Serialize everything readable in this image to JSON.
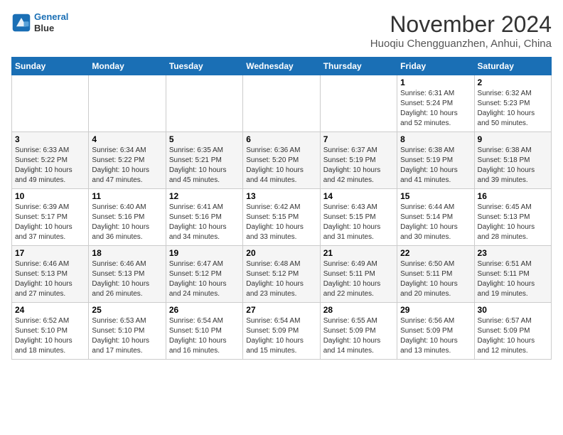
{
  "logo": {
    "line1": "General",
    "line2": "Blue"
  },
  "title": "November 2024",
  "location": "Huoqiu Chengguanzhen, Anhui, China",
  "weekdays": [
    "Sunday",
    "Monday",
    "Tuesday",
    "Wednesday",
    "Thursday",
    "Friday",
    "Saturday"
  ],
  "weeks": [
    [
      {
        "day": "",
        "info": ""
      },
      {
        "day": "",
        "info": ""
      },
      {
        "day": "",
        "info": ""
      },
      {
        "day": "",
        "info": ""
      },
      {
        "day": "",
        "info": ""
      },
      {
        "day": "1",
        "info": "Sunrise: 6:31 AM\nSunset: 5:24 PM\nDaylight: 10 hours and 52 minutes."
      },
      {
        "day": "2",
        "info": "Sunrise: 6:32 AM\nSunset: 5:23 PM\nDaylight: 10 hours and 50 minutes."
      }
    ],
    [
      {
        "day": "3",
        "info": "Sunrise: 6:33 AM\nSunset: 5:22 PM\nDaylight: 10 hours and 49 minutes."
      },
      {
        "day": "4",
        "info": "Sunrise: 6:34 AM\nSunset: 5:22 PM\nDaylight: 10 hours and 47 minutes."
      },
      {
        "day": "5",
        "info": "Sunrise: 6:35 AM\nSunset: 5:21 PM\nDaylight: 10 hours and 45 minutes."
      },
      {
        "day": "6",
        "info": "Sunrise: 6:36 AM\nSunset: 5:20 PM\nDaylight: 10 hours and 44 minutes."
      },
      {
        "day": "7",
        "info": "Sunrise: 6:37 AM\nSunset: 5:19 PM\nDaylight: 10 hours and 42 minutes."
      },
      {
        "day": "8",
        "info": "Sunrise: 6:38 AM\nSunset: 5:19 PM\nDaylight: 10 hours and 41 minutes."
      },
      {
        "day": "9",
        "info": "Sunrise: 6:38 AM\nSunset: 5:18 PM\nDaylight: 10 hours and 39 minutes."
      }
    ],
    [
      {
        "day": "10",
        "info": "Sunrise: 6:39 AM\nSunset: 5:17 PM\nDaylight: 10 hours and 37 minutes."
      },
      {
        "day": "11",
        "info": "Sunrise: 6:40 AM\nSunset: 5:16 PM\nDaylight: 10 hours and 36 minutes."
      },
      {
        "day": "12",
        "info": "Sunrise: 6:41 AM\nSunset: 5:16 PM\nDaylight: 10 hours and 34 minutes."
      },
      {
        "day": "13",
        "info": "Sunrise: 6:42 AM\nSunset: 5:15 PM\nDaylight: 10 hours and 33 minutes."
      },
      {
        "day": "14",
        "info": "Sunrise: 6:43 AM\nSunset: 5:15 PM\nDaylight: 10 hours and 31 minutes."
      },
      {
        "day": "15",
        "info": "Sunrise: 6:44 AM\nSunset: 5:14 PM\nDaylight: 10 hours and 30 minutes."
      },
      {
        "day": "16",
        "info": "Sunrise: 6:45 AM\nSunset: 5:13 PM\nDaylight: 10 hours and 28 minutes."
      }
    ],
    [
      {
        "day": "17",
        "info": "Sunrise: 6:46 AM\nSunset: 5:13 PM\nDaylight: 10 hours and 27 minutes."
      },
      {
        "day": "18",
        "info": "Sunrise: 6:46 AM\nSunset: 5:13 PM\nDaylight: 10 hours and 26 minutes."
      },
      {
        "day": "19",
        "info": "Sunrise: 6:47 AM\nSunset: 5:12 PM\nDaylight: 10 hours and 24 minutes."
      },
      {
        "day": "20",
        "info": "Sunrise: 6:48 AM\nSunset: 5:12 PM\nDaylight: 10 hours and 23 minutes."
      },
      {
        "day": "21",
        "info": "Sunrise: 6:49 AM\nSunset: 5:11 PM\nDaylight: 10 hours and 22 minutes."
      },
      {
        "day": "22",
        "info": "Sunrise: 6:50 AM\nSunset: 5:11 PM\nDaylight: 10 hours and 20 minutes."
      },
      {
        "day": "23",
        "info": "Sunrise: 6:51 AM\nSunset: 5:11 PM\nDaylight: 10 hours and 19 minutes."
      }
    ],
    [
      {
        "day": "24",
        "info": "Sunrise: 6:52 AM\nSunset: 5:10 PM\nDaylight: 10 hours and 18 minutes."
      },
      {
        "day": "25",
        "info": "Sunrise: 6:53 AM\nSunset: 5:10 PM\nDaylight: 10 hours and 17 minutes."
      },
      {
        "day": "26",
        "info": "Sunrise: 6:54 AM\nSunset: 5:10 PM\nDaylight: 10 hours and 16 minutes."
      },
      {
        "day": "27",
        "info": "Sunrise: 6:54 AM\nSunset: 5:09 PM\nDaylight: 10 hours and 15 minutes."
      },
      {
        "day": "28",
        "info": "Sunrise: 6:55 AM\nSunset: 5:09 PM\nDaylight: 10 hours and 14 minutes."
      },
      {
        "day": "29",
        "info": "Sunrise: 6:56 AM\nSunset: 5:09 PM\nDaylight: 10 hours and 13 minutes."
      },
      {
        "day": "30",
        "info": "Sunrise: 6:57 AM\nSunset: 5:09 PM\nDaylight: 10 hours and 12 minutes."
      }
    ]
  ]
}
